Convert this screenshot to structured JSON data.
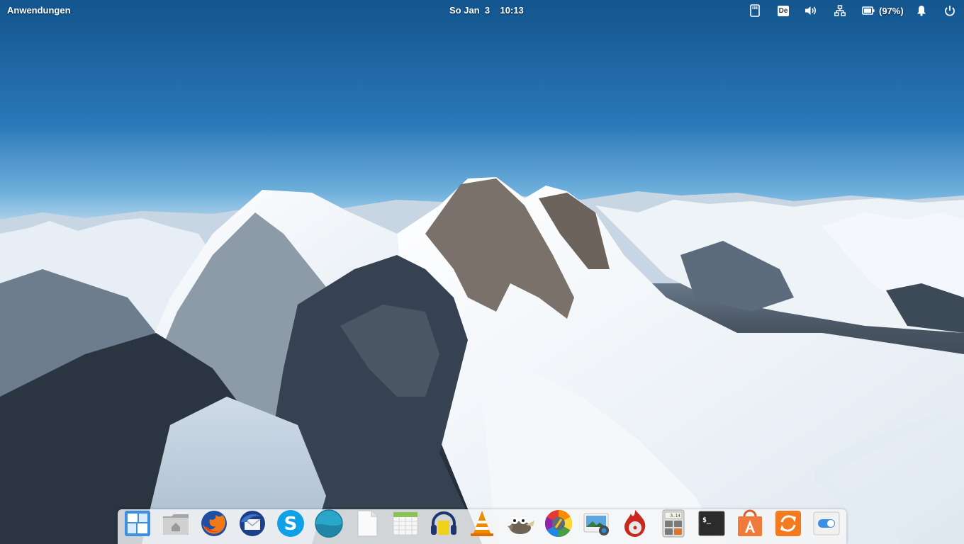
{
  "top_panel": {
    "applications_label": "Anwendungen",
    "date_time": "So Jan  3    10:13",
    "keyboard_layout": "De",
    "battery_percent": "(97%)"
  },
  "indicators": [
    "storage-icon",
    "keyboard-layout",
    "volume-icon",
    "network-icon",
    "battery-icon",
    "notifications-icon",
    "power-icon"
  ],
  "dock": {
    "items": [
      {
        "name": "multitasking-view",
        "icon": "multitasking-view-icon"
      },
      {
        "name": "files",
        "icon": "folder-home-icon"
      },
      {
        "name": "firefox",
        "icon": "firefox-icon"
      },
      {
        "name": "thunderbird",
        "icon": "thunderbird-icon"
      },
      {
        "name": "skype",
        "icon": "skype-icon"
      },
      {
        "name": "midori",
        "icon": "midori-icon"
      },
      {
        "name": "libreoffice",
        "icon": "document-icon"
      },
      {
        "name": "calendar",
        "icon": "calendar-icon"
      },
      {
        "name": "audacious",
        "icon": "headphones-icon"
      },
      {
        "name": "vlc",
        "icon": "vlc-cone-icon"
      },
      {
        "name": "gimp",
        "icon": "gimp-icon"
      },
      {
        "name": "color-picker",
        "icon": "color-wheel-icon"
      },
      {
        "name": "shotwell",
        "icon": "photo-viewer-icon"
      },
      {
        "name": "burner",
        "icon": "flame-disc-icon"
      },
      {
        "name": "calculator",
        "icon": "calculator-icon"
      },
      {
        "name": "terminal",
        "icon": "terminal-icon"
      },
      {
        "name": "appcenter",
        "icon": "appcenter-icon"
      },
      {
        "name": "software-update",
        "icon": "update-icon"
      },
      {
        "name": "settings",
        "icon": "settings-toggle-icon"
      }
    ],
    "calculator_display": "3.14",
    "terminal_prompt": "$_"
  },
  "colors": {
    "sky_top": "#15578f",
    "sky_horizon": "#9fcbe8",
    "dock_background": "#f5f5f5",
    "panel_text": "#ffffff"
  }
}
